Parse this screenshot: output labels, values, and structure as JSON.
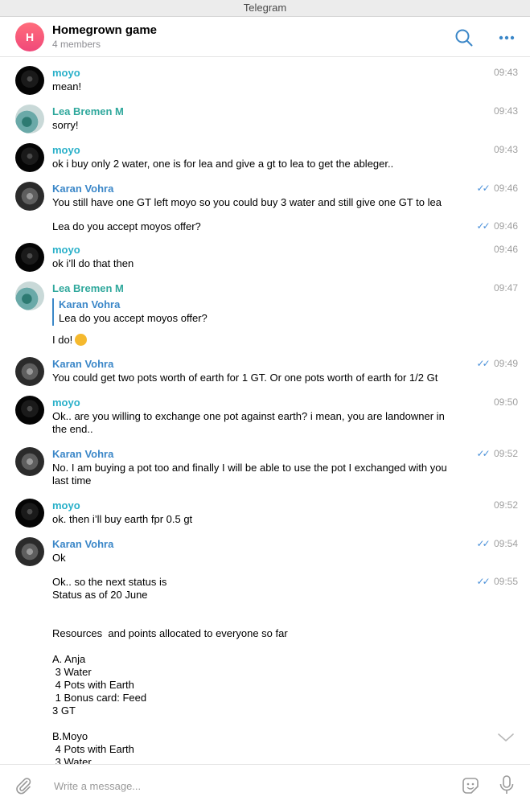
{
  "window": {
    "title": "Telegram"
  },
  "chat": {
    "avatar_letter": "H",
    "title": "Homegrown game",
    "subtitle": "4 members"
  },
  "messages": [
    {
      "sender": "moyo",
      "text": "mean!",
      "time": "09:43"
    },
    {
      "sender": "Lea Bremen M",
      "text": "sorry!",
      "time": "09:43"
    },
    {
      "sender": "moyo",
      "text": "ok i buy only 2 water, one is for lea and give a gt to lea to get the ableger..",
      "time": "09:43"
    },
    {
      "sender": "Karan Vohra",
      "text": "You still have one GT left moyo so you could buy 3 water and still give one GT to lea",
      "time": "09:46"
    },
    {
      "sender": "",
      "text": "Lea do you accept moyos offer?",
      "time": "09:46"
    },
    {
      "sender": "moyo",
      "text": "ok i’ll do that then",
      "time": "09:46"
    },
    {
      "sender": "Lea Bremen M",
      "reply_name": "Karan Vohra",
      "reply_text": "Lea do you accept moyos offer?",
      "text": "I do!",
      "time": "09:47"
    },
    {
      "sender": "Karan Vohra",
      "text": "You could get two pots worth of earth for 1 GT. Or one pots worth of earth for 1/2 Gt",
      "time": "09:49"
    },
    {
      "sender": "moyo",
      "text": "Ok.. are you willing to exchange one pot against earth? i mean, you are landowner in\nthe end..",
      "time": "09:50"
    },
    {
      "sender": "Karan Vohra",
      "text": "No. I am buying a pot too and finally I will be able to use the pot I exchanged with you\nlast time",
      "time": "09:52"
    },
    {
      "sender": "moyo",
      "text": "ok. then i’ll buy earth fpr 0.5 gt",
      "time": "09:52"
    },
    {
      "sender": "Karan Vohra",
      "text": "Ok",
      "time": "09:54"
    },
    {
      "sender": "",
      "text": "Ok.. so the next status is\nStatus as of 20 June\n\n\nResources  and points allocated to everyone so far\n\nA. Anja\n 3 Water\n 4 Pots with Earth\n 1 Bonus card: Feed\n3 GT\n\nB.Moyo\n 4 Pots with Earth\n 3 Water",
      "time": "09:55"
    }
  ],
  "composer": {
    "placeholder": "Write a message..."
  },
  "icons": {
    "search": "search-icon",
    "more": "more-icon",
    "attach": "paperclip-icon",
    "sticker": "sticker-icon",
    "mic": "microphone-icon",
    "read": "double-check-icon",
    "scroll": "chevron-down-icon"
  },
  "colors": {
    "accent": "#3b87c8",
    "moyo": "#29b0c9",
    "lea": "#2fa89c",
    "karan": "#3b87c8",
    "check": "#4a90d9",
    "time": "#a0a0a0"
  }
}
